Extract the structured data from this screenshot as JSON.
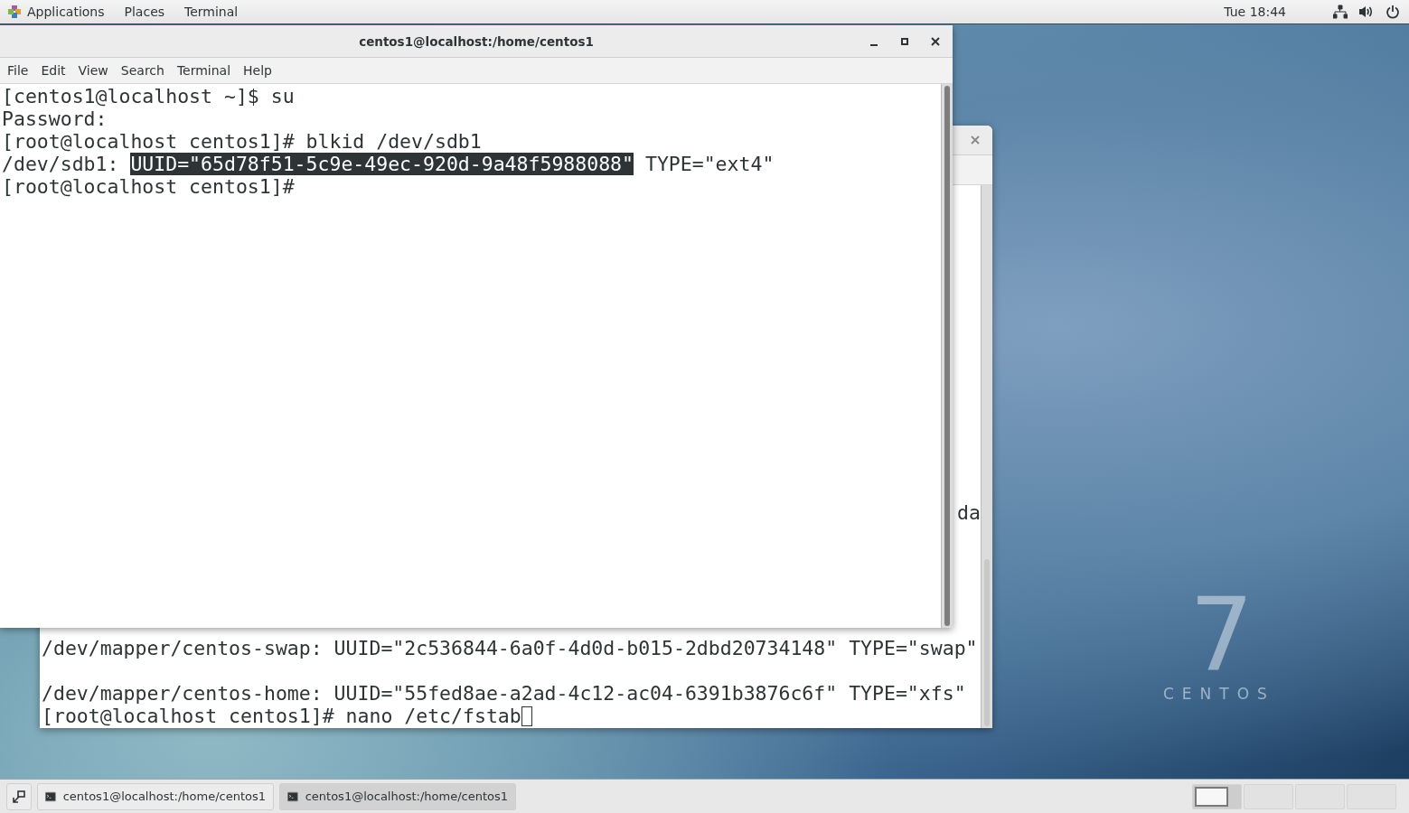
{
  "top_bar": {
    "menus": [
      {
        "label": "Applications",
        "kind": "apps"
      },
      {
        "label": "Places",
        "kind": "plain"
      },
      {
        "label": "Terminal",
        "kind": "plain"
      }
    ],
    "clock": "Tue 18:44"
  },
  "back_window": {
    "fragment": "da",
    "blocks": [
      [
        {
          "text": "/dev/mapper/centos-swap: UUID=\"2c536844-6a0f-4d0d-b015-2dbd20734148\" TYPE=\"swap\"",
          "cursor": false
        }
      ],
      [
        {
          "text": "/dev/mapper/centos-home: UUID=\"55fed8ae-a2ad-4c12-ac04-6391b3876c6f\" TYPE=\"xfs\"",
          "cursor": false
        },
        {
          "text": "[root@localhost centos1]# nano /etc/fstab",
          "cursor": true
        }
      ]
    ]
  },
  "front_window": {
    "title": "centos1@localhost:/home/centos1",
    "menu": [
      "File",
      "Edit",
      "View",
      "Search",
      "Terminal",
      "Help"
    ],
    "lines": [
      [
        {
          "text": "[centos1@localhost ~]$ su",
          "selected": false
        }
      ],
      [
        {
          "text": "Password:",
          "selected": false
        }
      ],
      [
        {
          "text": "[root@localhost centos1]# blkid /dev/sdb1",
          "selected": false
        }
      ],
      [
        {
          "text": "/dev/sdb1: ",
          "selected": false
        },
        {
          "text": "UUID=\"65d78f51-5c9e-49ec-920d-9a48f5988088\"",
          "selected": true
        },
        {
          "text": " TYPE=\"ext4\"",
          "selected": false
        }
      ],
      [
        {
          "text": "[root@localhost centos1]#",
          "selected": false
        }
      ]
    ]
  },
  "desktop": {
    "logo_number": "7",
    "logo_text": "CENTOS"
  },
  "taskbar": {
    "windows": [
      {
        "label": "centos1@localhost:/home/centos1",
        "selected": false
      },
      {
        "label": "centos1@localhost:/home/centos1",
        "selected": true
      }
    ],
    "workspaces": [
      {
        "selected": true
      },
      {
        "selected": false
      },
      {
        "selected": false
      },
      {
        "selected": false
      }
    ]
  }
}
